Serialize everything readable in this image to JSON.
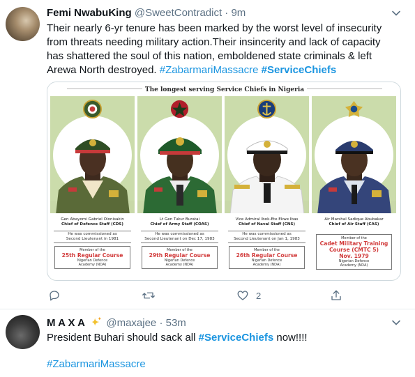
{
  "tweet1": {
    "display_name": "Femi NwabuKing",
    "handle": "@SweetContradict",
    "separator": "·",
    "time": "9m",
    "text": "Their nearly 6-yr tenure has been marked by the worst level of insecurity from threats needing military action.Their insincerity and lack of capacity has shattered the soul of this nation, emboldened state criminals & left Arewa North destroyed.",
    "hashtag1": "#ZabarmariMassacre",
    "hashtag2": "#ServiceChiefs",
    "media": {
      "banner": "The longest serving Service Chiefs in Nigeria",
      "chiefs": [
        {
          "name": "Gen Abayomi Gabriel Olonisakin",
          "role": "Chief of Defence Staff (CDS)",
          "commission": [
            "He was commissioned as",
            "Second Lieutenant in 1981"
          ],
          "member": "Member of the",
          "course": [
            "25th Regular Course"
          ],
          "academy": [
            "Nigerian Defence",
            "Academy (NDA)"
          ],
          "colors": {
            "cap": "#2f4d24",
            "uniform": "#5a6a38",
            "bg": "#cbdcab"
          }
        },
        {
          "name": "Lt Gen Tukur Buratai",
          "role": "Chief of Army Staff (COAS)",
          "commission": [
            "He was commissioned as",
            "Second Lieutenant on Dec 17, 1983"
          ],
          "member": "Member of the",
          "course": [
            "29th Regular Course"
          ],
          "academy": [
            "Nigerian Defence",
            "Academy (NDA)"
          ],
          "colors": {
            "cap": "#1f5a2a",
            "uniform": "#2c6a34",
            "bg": "#cbdcab"
          }
        },
        {
          "name": "Vice Admiral Ibok-Ete Ekwe Ibas",
          "role": "Chief of Naval Staff (CNS)",
          "commission": [
            "He was commissioned as",
            "Second Lieutenant on Jan 1, 1983"
          ],
          "member": "Member of the",
          "course": [
            "26th Regular Course"
          ],
          "academy": [
            "Nigerian Defence",
            "Academy (NDA)"
          ],
          "colors": {
            "cap": "#ffffff",
            "uniform": "#f4f4f4",
            "bg": "#cbdcab"
          }
        },
        {
          "name": "Air Marshal Sadique Abubakar",
          "role": "Chief of Air Staff (CAS)",
          "commission": [
            "",
            ""
          ],
          "member": "Member of the",
          "course": [
            "Cadet Military Training",
            "Course (CMTC 5)",
            "Nov. 1979"
          ],
          "academy": [
            "Nigerian Defence",
            "Academy (NDA)"
          ],
          "colors": {
            "cap": "#2a3c6e",
            "uniform": "#34457a",
            "bg": "#cbdcab"
          }
        }
      ]
    },
    "actions": {
      "reply": "",
      "retweet": "",
      "like": "2",
      "share": ""
    }
  },
  "tweet2": {
    "display_name": "M A X A",
    "handle": "@maxajee",
    "separator": "·",
    "time": "53m",
    "text_prefix": "President Buhari should sack all",
    "hashtag1": "#ServiceChiefs",
    "text_suffix": "now!!!!",
    "hashtag2": "#ZabarmariMassacre"
  },
  "colors": {
    "link": "#1b95e0",
    "muted": "#5b7083",
    "text": "#0f1419",
    "panel_green": "#cbdcab",
    "course_red": "#d13a3a"
  }
}
